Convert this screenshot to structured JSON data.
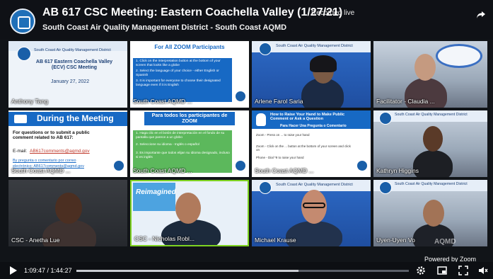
{
  "header": {
    "title": "AB 617 CSC Meeting: Eastern Coachella Valley (1/27/21)",
    "recorded_label": "Recorded live",
    "subtitle": "South Coast Air Quality Management District - South Coast AQMD"
  },
  "tiles": [
    {
      "name": "Anthony Tang",
      "slide_org": "South Coast Air Quality Management District",
      "slide_title": "AB 617 Eastern Coachella Valley (ECV) CSC Meeting",
      "slide_date": "January 27, 2022"
    },
    {
      "name": "South Coast AQMD ...",
      "slide_title": "For All ZOOM Participants",
      "bullets": [
        "1. Click on the interpretation button at the bottom of your screen that looks like a globe",
        "2. Select the language of your choice - either English or Spanish",
        "3. It is important for everyone to choose their designated language even if it is English"
      ]
    },
    {
      "name": "Arlene Farol Saria",
      "slide_org": "South Coast Air Quality Management District"
    },
    {
      "name": "Facilitator - Claudia ..."
    },
    {
      "name": "South Coast AQMD ...",
      "slide_title": "During the Meeting",
      "question": "For questions or to submit a public comment related to AB 617:",
      "email_label": "E-mail:",
      "email": "AB617comments@aqmd.gov",
      "mail_line1": "By pregunta o comentario por correo",
      "mail_line2": "electrónico: AB617comments@aqmd.gov"
    },
    {
      "name": "South Coast AQMD ...",
      "slide_title": "Para todos los participantes de ZOOM",
      "bullets": [
        "1. Haga clic en el botón de interpretación en el fondo de su pantalla que parece a un globo",
        "2. Seleccione su idioma - Inglés o español",
        "3. Es importante que todos elijan su idioma designado, incluso si es inglés"
      ]
    },
    {
      "name": "South Coast AQMD ...",
      "slide_title": "How to Raise Your Hand to Make Public Comment or Ask a Question",
      "slide_subtitle": "Para Hacer Una Pregunta o Comentario",
      "steps": [
        "Zoom - Press on ... to raise your hand",
        "Zoom - Click on the ... button at the bottom of your screen and click on",
        "Phone - Dial *9 to raise your hand"
      ]
    },
    {
      "name": "Kathryn Higgins",
      "slide_org": "South Coast Air Quality Management District"
    },
    {
      "name": "CSC - Anetha Lue"
    },
    {
      "name": "CSC - Nicholas Robl...",
      "poster": "Reimagined"
    },
    {
      "name": "Michael Krause",
      "slide_org": "South Coast Air Quality Management District"
    },
    {
      "name": "Uyen-Uyen Vo",
      "slide_org": "South Coast Air Quality Management District"
    }
  ],
  "watermark": "AQMD",
  "controls": {
    "current_time": "1:09:47",
    "duration": "1:44:27",
    "time_separator": " / ",
    "progress": 0.668,
    "powered_by": "Powered by Zoom"
  },
  "colors": {
    "active_speaker_border": "#7ed321",
    "aqmd_blue": "#1a5fa8",
    "progress_fill": "#c9ccd2"
  }
}
